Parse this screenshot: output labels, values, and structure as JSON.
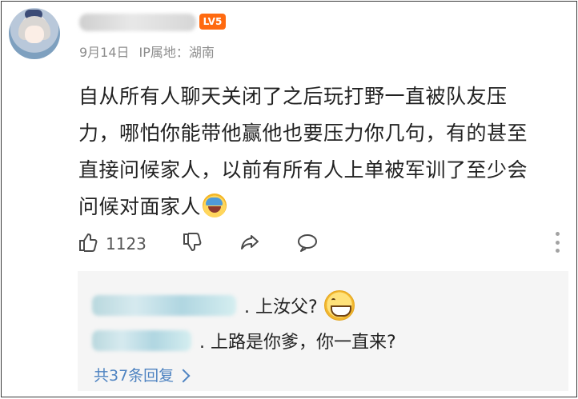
{
  "comment": {
    "date": "9月14日",
    "ip_location": "IP属地：湖南",
    "level_badge": "LV5",
    "text_lines": [
      "自从所有人聊天关闭了之后玩打野一直被队友压",
      "力，哪怕你能带他赢他也要压力你几句，有的甚至",
      "直接问候家人，以前有所有人上单被军训了至少会",
      "问候对面家人"
    ],
    "actions": {
      "likes": "1123"
    }
  },
  "replies": [
    {
      "text": ". 上汝父?"
    },
    {
      "text": ". 上路是你爹，你一直来?"
    }
  ],
  "reply_summary": "共37条回复",
  "icons": {
    "avatar": "avatar-icon",
    "thumb_up": "thumb-up-icon",
    "thumb_down": "thumb-down-icon",
    "share": "share-icon",
    "comment": "comment-icon",
    "more": "more-vertical-icon",
    "emoji_1": "wink-emoji-icon",
    "emoji_2": "grin-emoji-icon",
    "chevron": "chevron-right-icon"
  },
  "colors": {
    "background": "#ffffff",
    "reply_background": "#f5f5f5",
    "meta_text": "#8d8d8d",
    "link": "#4e83c1",
    "level_badge": "#ff6a10"
  }
}
